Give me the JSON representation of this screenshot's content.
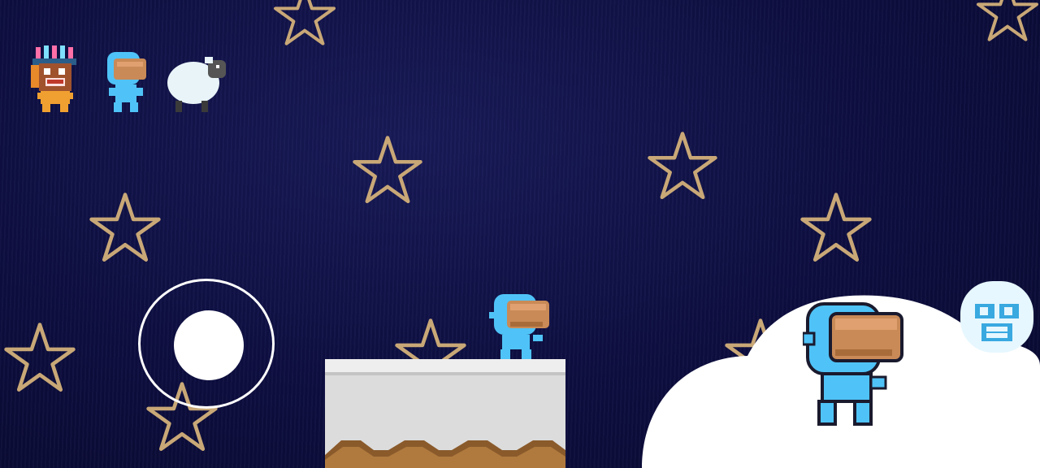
{
  "game": {
    "background_color": "#0d0d3f",
    "accent_cloud_color": "#ffffff",
    "player_color": "#4fc3f7",
    "helmet_color": "#c98a57"
  },
  "hud": {
    "characters": [
      {
        "icon": "tribal-mask-character-icon"
      },
      {
        "icon": "astronaut-character-icon"
      },
      {
        "icon": "sheep-character-icon"
      }
    ]
  },
  "controls": {
    "joystick": {
      "icon": "virtual-joystick"
    }
  }
}
